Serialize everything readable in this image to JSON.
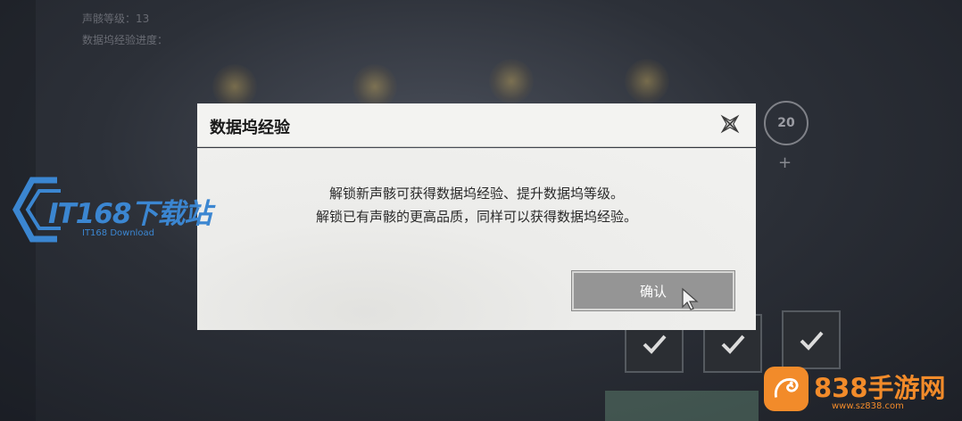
{
  "background": {
    "level_text": "声骸等级：13",
    "progress_text": "数据坞经验进度：",
    "level_badge": "20",
    "accent": "#f28b2a"
  },
  "dialog": {
    "title": "数据坞经验",
    "line1": "解锁新声骸可获得数据坞经验、提升数据坞等级。",
    "line2": "解锁已有声骸的更高品质，同样可以获得数据坞经验。",
    "confirm_label": "确认",
    "close_icon": "close-icon"
  },
  "watermarks": {
    "it168_title": "IT168下载站",
    "it168_sub": "IT168 Download",
    "site838_title": "838手游网",
    "site838_sub": "www.sz838.com",
    "it168_color": "#3b86d1",
    "site838_color": "#f28b2a"
  }
}
